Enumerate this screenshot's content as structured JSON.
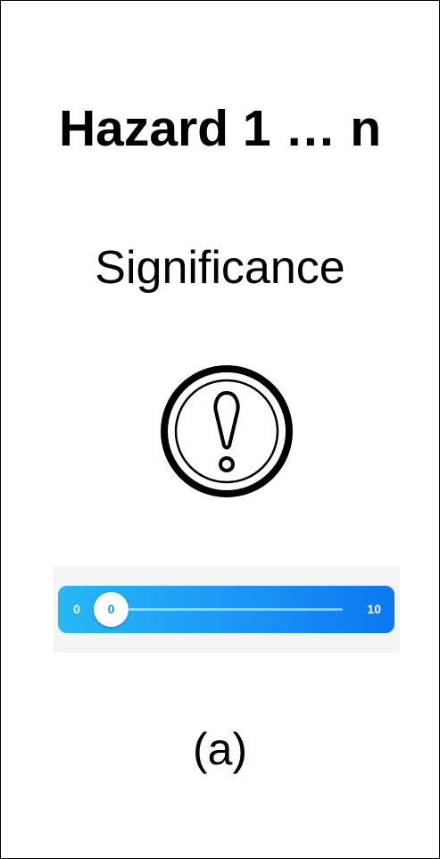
{
  "screen": {
    "title": "Hazard 1 … n",
    "subtitle": "Significance",
    "icon": "exclamation-circle-icon",
    "caption": "(a)"
  },
  "slider": {
    "min_label": "0",
    "max_label": "10",
    "min": 0,
    "max": 10,
    "value": 0,
    "value_label": "0",
    "gradient_colors": [
      "#27b8f4",
      "#0a78f2"
    ],
    "thumb_text_color": "#1f8ef0"
  }
}
